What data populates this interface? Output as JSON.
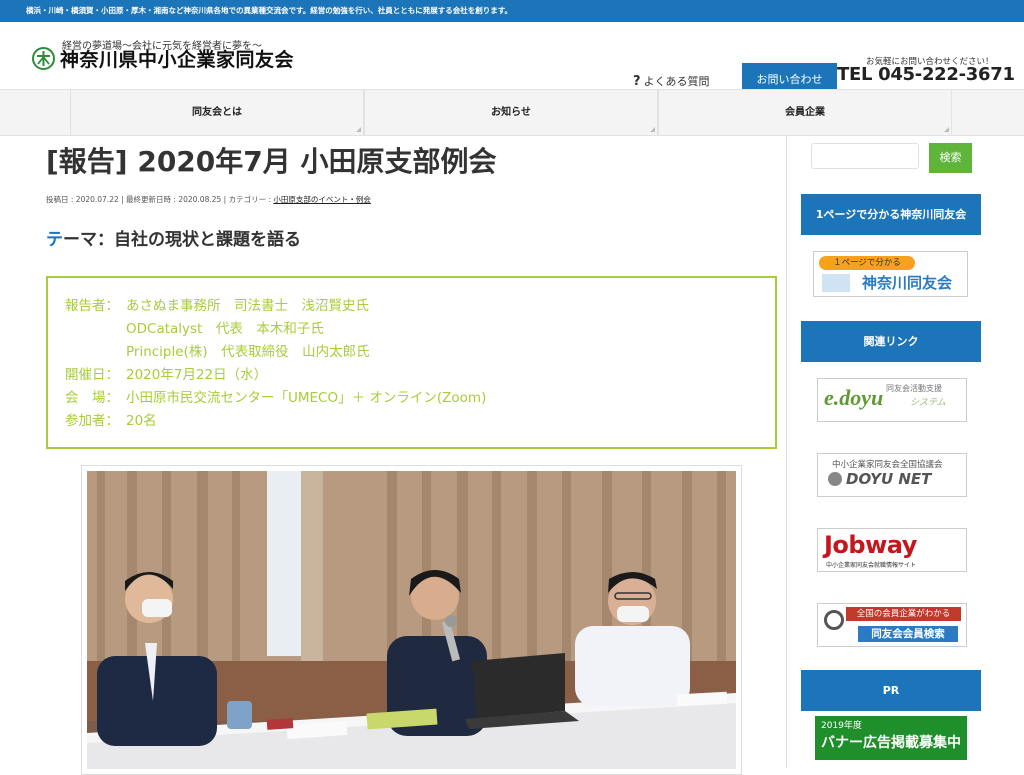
{
  "topbar": {
    "text": "横浜・川崎・横須賀・小田原・厚木・湘南など神奈川県各地での異業種交流会です。経営の勉強を行い、社員とともに発展する会社を創ります。"
  },
  "header": {
    "tagline": "経営の夢道場～会社に元気を経営者に夢を～",
    "site_name": "神奈川県中小企業家同友会",
    "faq_label": "よくある質問",
    "contact_label": "お問い合わせ",
    "tel_note": "お気軽にお問い合わせください！",
    "tel": "TEL 045-222-3671"
  },
  "nav": {
    "items": [
      {
        "label": "同友会とは"
      },
      {
        "label": "お知らせ"
      },
      {
        "label": "会員企業"
      }
    ]
  },
  "post": {
    "title": "[報告] 2020年7月 小田原支部例会",
    "meta_prefix": "投稿日 : 2020.07.22 | 最終更新日時 : 2020.08.25 | カテゴリー : ",
    "category": "小田原支部のイベント・例会",
    "theme_accent": "テ",
    "theme_rest": "ーマ：自社の現状と課題を語る",
    "report": [
      {
        "label": "報告者：",
        "value": "あさぬま事務所　司法書士　浅沼賢史氏"
      },
      {
        "label": "",
        "value": "ODCatalyst　代表　本木和子氏"
      },
      {
        "label": "",
        "value": "Principle(株)　代表取締役　山内太郎氏"
      },
      {
        "label": "開催日：",
        "value": "2020年7月22日（水）"
      },
      {
        "label": "会　場：",
        "value": "小田原市民交流センター「UMECO」＋ オンライン(Zoom)"
      },
      {
        "label": "参加者：",
        "value": "20名"
      }
    ]
  },
  "sidebar": {
    "search_label": "検索",
    "head_1": "1ページで分かる神奈川同友会",
    "banner_1_top": "１ページで分かる",
    "banner_1_bottom": "神奈川同友会",
    "head_links": "関連リンク",
    "edoyu_logo": "e.doyu",
    "edoyu_sub1": "同友会活動支援",
    "edoyu_sub2": "システム",
    "doyunet_top": "中小企業家同友会全国協議会",
    "doyunet_main": "DOYU NET",
    "jobway_main": "Jobway",
    "jobway_sub": "中小企業家同友会就職情報サイト",
    "search_top": "全国の会員企業がわかる",
    "search_bottom": "同友会会員検索",
    "head_pr": "PR",
    "pr_year": "2019年度",
    "pr_text": "バナー広告掲載募集中"
  },
  "colors": {
    "brand_blue": "#1c75b9",
    "accent_green": "#a8cc3a",
    "search_green": "#5fb43a"
  }
}
